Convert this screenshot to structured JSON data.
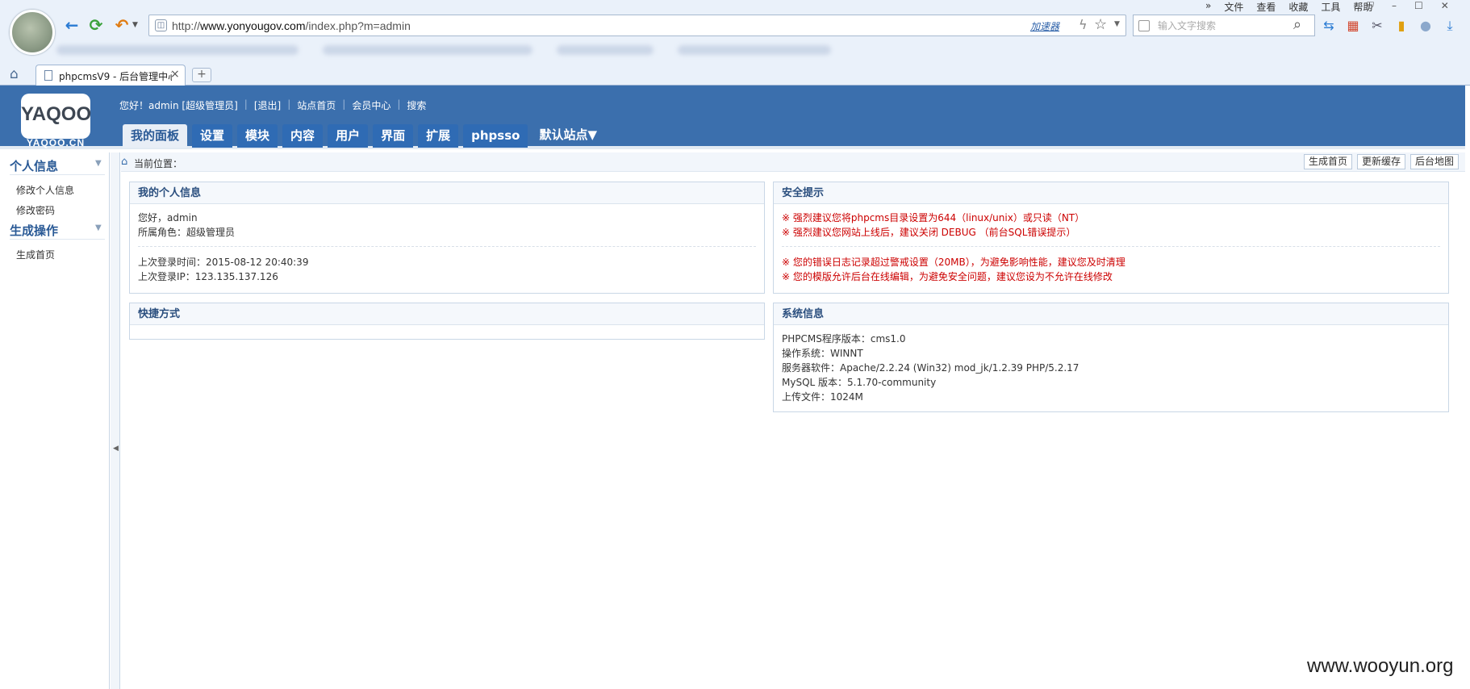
{
  "browser": {
    "url_prefix": "http://",
    "url_host": "www.yonyougov.com",
    "url_path": "/index.php?m=admin",
    "accelerator_label": "加速器",
    "search_placeholder": "输入文字搜索",
    "menu": [
      "文件",
      "查看",
      "收藏",
      "工具",
      "帮助"
    ],
    "tab_title": "phpcmsV9 - 后台管理中心"
  },
  "header": {
    "logo_text": "YAQOO",
    "logo_sub": "YAQOO.CN",
    "greeting": "您好！admin [超级管理员]",
    "logout": "[退出]",
    "site_home": "站点首页",
    "member_center": "会员中心",
    "search": "搜索",
    "nav": [
      "我的面板",
      "设置",
      "模块",
      "内容",
      "用户",
      "界面",
      "扩展",
      "phpsso"
    ],
    "site_switch": "默认站点▼"
  },
  "sidebar": {
    "group1_title": "个人信息",
    "group1_items": [
      "修改个人信息",
      "修改密码"
    ],
    "group2_title": "生成操作",
    "group2_items": [
      "生成首页"
    ]
  },
  "crumb": {
    "label": "当前位置：",
    "actions": [
      "生成首页",
      "更新缓存",
      "后台地图"
    ]
  },
  "my_info": {
    "title": "我的个人信息",
    "hello": "您好，admin",
    "role": "所属角色：超级管理员",
    "last_login_time": "上次登录时间：2015-08-12 20:40:39",
    "last_login_ip": "上次登录IP：123.135.137.126"
  },
  "security": {
    "title": "安全提示",
    "warnings_a": [
      "※ 强烈建议您将phpcms目录设置为644（linux/unix）或只读（NT）",
      "※ 强烈建议您网站上线后，建议关闭 DEBUG （前台SQL错误提示）"
    ],
    "warnings_b": [
      "※ 您的错误日志记录超过警戒设置（20MB），为避免影响性能，建议您及时清理",
      "※ 您的模版允许后台在线编辑，为避免安全问题，建议您设为不允许在线修改"
    ]
  },
  "shortcuts": {
    "title": "快捷方式"
  },
  "system": {
    "title": "系统信息",
    "lines": [
      "PHPCMS程序版本：cms1.0",
      "操作系统：WINNT",
      "服务器软件：Apache/2.2.24 (Win32) mod_jk/1.2.39 PHP/5.2.17",
      "MySQL 版本：5.1.70-community",
      "上传文件：1024M"
    ]
  },
  "watermark": "www.wooyun.org",
  "icons": {
    "back": "arrow-left-icon",
    "refresh": "refresh-icon",
    "undo": "undo-icon",
    "home": "home-icon",
    "star": "star-icon",
    "search": "search-icon"
  },
  "colors": {
    "header_bg": "#3b6fad",
    "warning": "#cc0000",
    "panel_title": "#2a4e7e"
  }
}
